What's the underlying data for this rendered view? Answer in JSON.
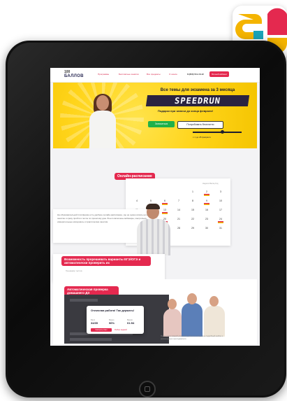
{
  "site": {
    "brand_top": "100",
    "brand_name": "БАЛЛОВ",
    "nav": [
      "Программы",
      "Бесплатные занятия",
      "Все предметы",
      "О школе"
    ],
    "phone": "8 (800) 511-16-42",
    "cta": "Личный кабинет"
  },
  "hero": {
    "title": "Все темы для экзамена за 3 месяца",
    "banner": "SPEEDRUN",
    "gift": "Подарки при записи до конца февраля!",
    "button_primary": "Записаться",
    "button_secondary": "Попробовать бесплатно",
    "date": "с 1 до 28 февраля"
  },
  "schedule": {
    "label": "Онлайн-расписание",
    "tabs": "Неделя  Месяц  Год",
    "days": [
      "",
      "",
      "",
      "",
      "1",
      "2",
      "3",
      "4",
      "5",
      "6",
      "7",
      "8",
      "9",
      "10",
      "11",
      "12",
      "13",
      "14",
      "15",
      "16",
      "17",
      "18",
      "19",
      "20",
      "21",
      "22",
      "23",
      "24",
      "25",
      "26",
      "27",
      "28",
      "29",
      "30",
      "31"
    ],
    "description": "На образовательной платформе есть удобное онлайн-расписание, где не нужно искать ни одно занятие и сразу пройти и после по прошлому дню. В него включены вебинары, контрольно-измерительные материалы и практические занятия."
  },
  "practice": {
    "title": "Возможность прорешивать варианты ЕГЭ/ОГЭ и автоматически проверить их",
    "sub": "Тренажёр тестов"
  },
  "check": {
    "label": "Автоматическая проверка домашнего ДЗ",
    "result_title": "Отличная работа! Так держать!",
    "stats": [
      {
        "label": "Балл",
        "value": "34/35"
      },
      {
        "label": "Верно",
        "value": "96%"
      },
      {
        "label": "Время",
        "value": "01:54"
      }
    ],
    "result_primary": "Смотреть ответ",
    "result_secondary": "Разбор заданий",
    "footnote": "После сдачи каждой домашней работы ты получишь подробный разбор и рекомендации преподавателя."
  },
  "colors": {
    "accent": "#e4294f",
    "hero_bg": "#ffd41a",
    "success": "#20b14a"
  }
}
